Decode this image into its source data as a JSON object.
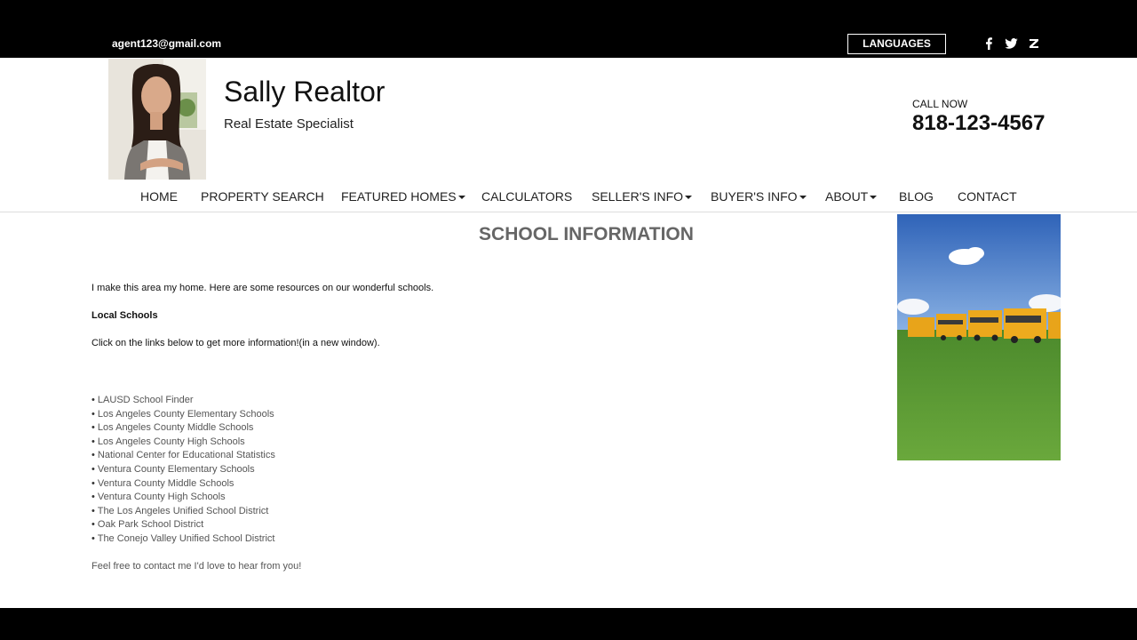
{
  "topbar": {
    "email": "agent123@gmail.com",
    "languages_label": "LANGUAGES",
    "social": [
      "facebook-icon",
      "twitter-icon",
      "zillow-icon"
    ]
  },
  "header": {
    "name": "Sally Realtor",
    "subtitle": "Real Estate Specialist",
    "call_label": "CALL NOW",
    "phone": "818-123-4567"
  },
  "nav": {
    "items": [
      {
        "label": "HOME",
        "dropdown": false
      },
      {
        "label": "PROPERTY SEARCH",
        "dropdown": false
      },
      {
        "label": "FEATURED HOMES",
        "dropdown": true
      },
      {
        "label": "CALCULATORS",
        "dropdown": false
      },
      {
        "label": "SELLER'S INFO",
        "dropdown": true
      },
      {
        "label": "BUYER'S INFO",
        "dropdown": true
      },
      {
        "label": "ABOUT",
        "dropdown": true
      },
      {
        "label": "BLOG",
        "dropdown": false
      },
      {
        "label": "CONTACT",
        "dropdown": false
      }
    ]
  },
  "main": {
    "title": "SCHOOL INFORMATION",
    "intro": "I make this area my home. Here are some resources on our wonderful schools.",
    "section_heading": "Local Schools",
    "instructions": "Click on the links below to get more information!(in a new window).",
    "links": [
      "LAUSD School Finder",
      "Los Angeles County Elementary Schools",
      "Los Angeles County Middle Schools",
      "Los Angeles County High Schools",
      "National Center for Educational Statistics",
      "Ventura County Elementary Schools",
      "Ventura County Middle Schools",
      "Ventura County High Schools",
      "The Los Angeles Unified School District",
      "Oak Park School District",
      "The Conejo Valley Unified School District"
    ],
    "closing": "Feel free to contact me I'd love to hear from you!"
  },
  "colors": {
    "bar": "#000000",
    "title_gray": "#666666",
    "link_gray": "#555555"
  }
}
